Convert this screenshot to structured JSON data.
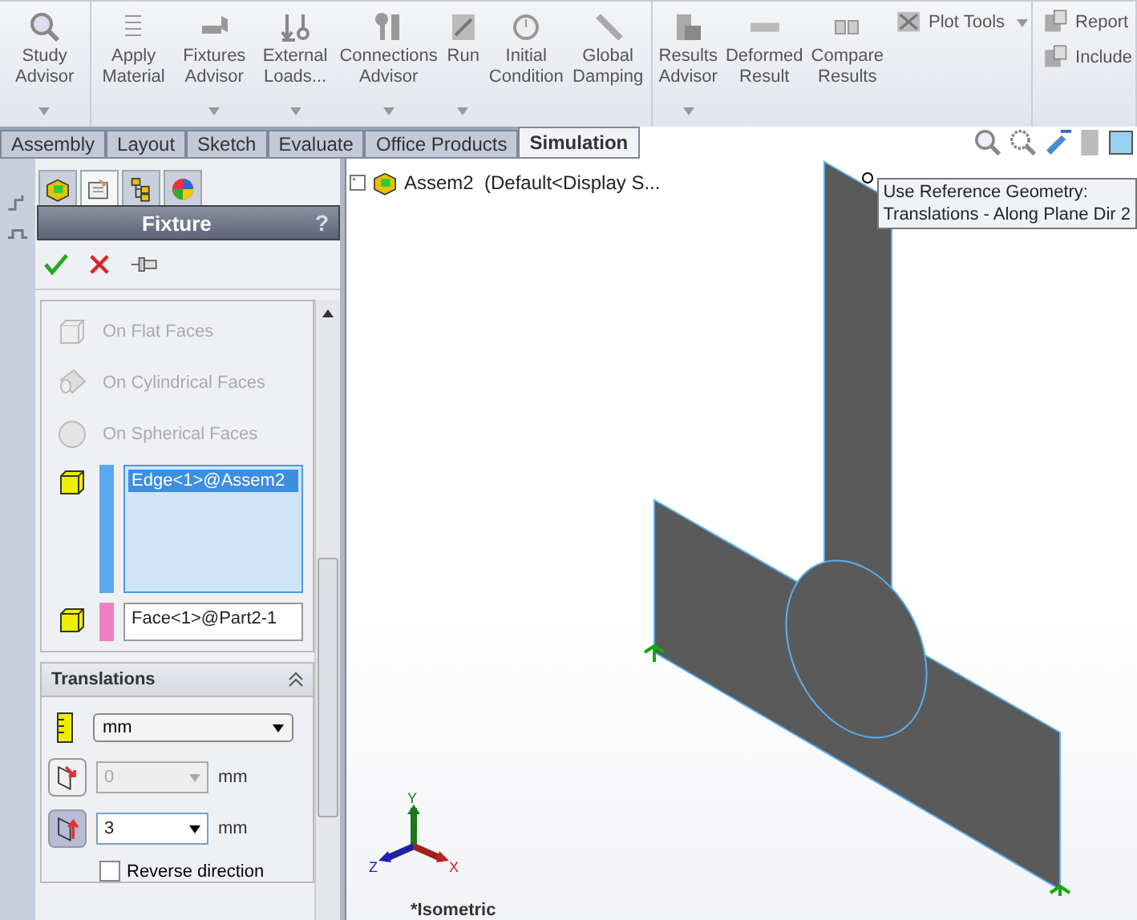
{
  "ribbon": {
    "groups": [
      {
        "large": [
          {
            "label": "Study Advisor",
            "dropdown": true
          }
        ]
      },
      {
        "large": [
          {
            "label": "Apply Material",
            "dropdown": false
          },
          {
            "label": "Fixtures Advisor",
            "dropdown": true
          },
          {
            "label": "External Loads...",
            "dropdown": true
          },
          {
            "label": "Connections Advisor",
            "dropdown": true
          },
          {
            "label": "Run",
            "dropdown": true
          },
          {
            "label": "Initial Condition",
            "dropdown": false
          },
          {
            "label": "Global Damping",
            "dropdown": false
          }
        ]
      },
      {
        "large": [
          {
            "label": "Results Advisor",
            "dropdown": true
          },
          {
            "label": "Deformed Result",
            "dropdown": false
          },
          {
            "label": "Compare Results",
            "dropdown": false
          }
        ],
        "small": [
          {
            "label": "Plot Tools",
            "dropdown": true
          }
        ]
      },
      {
        "small": [
          {
            "label": "Report",
            "dropdown": false
          },
          {
            "label": "Include",
            "dropdown": false
          }
        ]
      }
    ]
  },
  "tabs": [
    {
      "label": "Assembly",
      "selected": false
    },
    {
      "label": "Layout",
      "selected": false
    },
    {
      "label": "Sketch",
      "selected": false
    },
    {
      "label": "Evaluate",
      "selected": false
    },
    {
      "label": "Office Products",
      "selected": false
    },
    {
      "label": "Simulation",
      "selected": true
    }
  ],
  "property_manager": {
    "panel_tabs": [
      {
        "kind": "tree",
        "selected": false
      },
      {
        "kind": "property",
        "selected": true
      },
      {
        "kind": "config",
        "selected": false
      },
      {
        "kind": "display",
        "selected": false
      }
    ],
    "title": "Fixture",
    "help": "?",
    "fixture_types": [
      {
        "label": "On Flat Faces",
        "disabled": true
      },
      {
        "label": "On Cylindrical Faces",
        "disabled": true
      },
      {
        "label": "On Spherical Faces",
        "disabled": true
      }
    ],
    "selections": [
      {
        "kind": "list",
        "value": "Edge<1>@Assem2",
        "color": "#5aa8f0",
        "selected": true
      },
      {
        "kind": "single",
        "value": "Face<1>@Part2-1",
        "color": "#f080c0",
        "selected": false
      }
    ],
    "translations": {
      "title": "Translations",
      "expanded": true,
      "unit": "mm",
      "rows": [
        {
          "value": "0",
          "unit": "mm",
          "active": false
        },
        {
          "value": "3",
          "unit": "mm",
          "active": true
        }
      ],
      "reverse": {
        "label": "Reverse direction",
        "checked": false
      }
    }
  },
  "viewport": {
    "tree_root": {
      "label": "Assem2  (Default<Display S...",
      "expanded": false
    },
    "tooltip": [
      "Use Reference Geometry:",
      "Translations - Along Plane Dir 2"
    ],
    "triad": {
      "x": "X",
      "y": "Y",
      "z": "Z"
    },
    "view_name": "*Isometric"
  }
}
